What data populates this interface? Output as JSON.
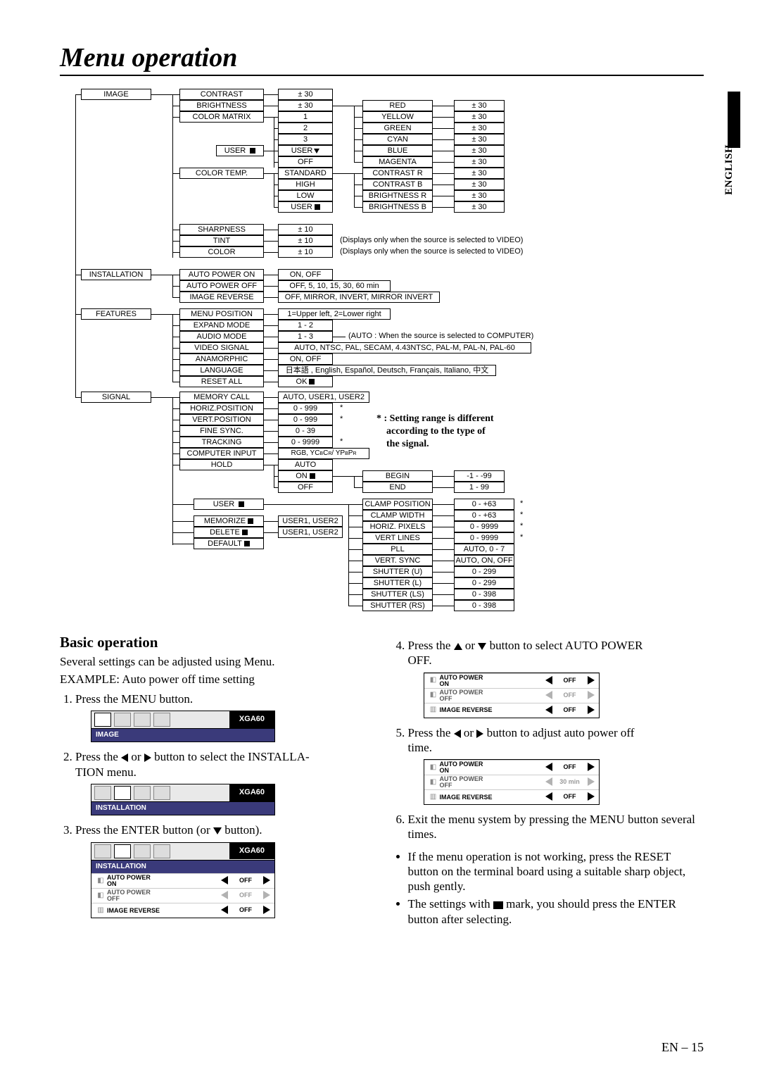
{
  "page": {
    "title": "Menu operation",
    "language_tab": "ENGLISH",
    "page_number": "EN – 15"
  },
  "tree": {
    "top": [
      {
        "label": "IMAGE",
        "items": [
          {
            "label": "CONTRAST",
            "value": "± 30"
          },
          {
            "label": "BRIGHTNESS",
            "value": "± 30"
          },
          {
            "label": "COLOR MATRIX",
            "sub": [
              {
                "value": "1"
              },
              {
                "value": "2"
              },
              {
                "value": "3"
              },
              {
                "value": "USER▼",
                "right": [
                  {
                    "label": "RED",
                    "value": "± 30"
                  },
                  {
                    "label": "YELLOW",
                    "value": "± 30"
                  },
                  {
                    "label": "GREEN",
                    "value": "± 30"
                  },
                  {
                    "label": "CYAN",
                    "value": "± 30"
                  },
                  {
                    "label": "BLUE",
                    "value": "± 30"
                  },
                  {
                    "label": "MAGENTA",
                    "value": "± 30"
                  }
                ]
              },
              {
                "value": "OFF"
              }
            ],
            "aside": {
              "label": "USER ■"
            }
          },
          {
            "label": "COLOR TEMP.",
            "sub": [
              {
                "value": "STANDARD",
                "right_label": "CONTRAST R",
                "right_value": "± 30"
              },
              {
                "value": "HIGH",
                "right_label": "CONTRAST B",
                "right_value": "± 30"
              },
              {
                "value": "LOW",
                "right_label": "BRIGHTNESS R",
                "right_value": "± 30"
              },
              {
                "value": "USER■",
                "right_label": "BRIGHTNESS B",
                "right_value": "± 30"
              }
            ]
          },
          {
            "label": "SHARPNESS",
            "value": "± 10"
          },
          {
            "label": "TINT",
            "value": "± 10",
            "note": "(Displays only when the source is selected to VIDEO)"
          },
          {
            "label": "COLOR",
            "value": "± 10",
            "note": "(Displays only when the source is selected to VIDEO)"
          }
        ]
      },
      {
        "label": "INSTALLATION",
        "items": [
          {
            "label": "AUTO POWER ON",
            "value": "ON, OFF"
          },
          {
            "label": "AUTO POWER OFF",
            "value": "OFF, 5, 10, 15, 30, 60 min"
          },
          {
            "label": "IMAGE REVERSE",
            "value": "OFF, MIRROR, INVERT, MIRROR INVERT"
          }
        ]
      },
      {
        "label": "FEATURES",
        "items": [
          {
            "label": "MENU POSITION",
            "value": "1=Upper left, 2=Lower right"
          },
          {
            "label": "EXPAND MODE",
            "value": "1 - 2"
          },
          {
            "label": "AUDIO MODE",
            "value": "1 - 3",
            "note": "(AUTO : When the source is selected to COMPUTER)"
          },
          {
            "label": "VIDEO SIGNAL",
            "value": "AUTO, NTSC, PAL, SECAM, 4.43NTSC, PAL-M, PAL-N, PAL-60"
          },
          {
            "label": "ANAMORPHIC",
            "value": "ON, OFF"
          },
          {
            "label": "LANGUAGE",
            "value": "日本語 , English, Español, Deutsch, Français, Italiano, 中文"
          },
          {
            "label": "RESET ALL",
            "value": "OK■"
          }
        ]
      },
      {
        "label": "SIGNAL",
        "items": [
          {
            "label": "MEMORY CALL",
            "value": "AUTO, USER1, USER2"
          },
          {
            "label": "HORIZ.POSITION",
            "value": "0 - 999",
            "ast": "*"
          },
          {
            "label": "VERT.POSITION",
            "value": "0 - 999",
            "ast": "*"
          },
          {
            "label": "FINE SYNC.",
            "value": "0 - 39"
          },
          {
            "label": "TRACKING",
            "value": "0 - 9999",
            "ast": "*"
          },
          {
            "label": "COMPUTER INPUT",
            "value": "RGB, YCBCR / YPBPR"
          },
          {
            "label": "HOLD",
            "sub": [
              {
                "value": "AUTO"
              },
              {
                "value": "ON■",
                "right_label": "BEGIN",
                "right_value": "-1 - -99"
              },
              {
                "value": "OFF",
                "right_label": "END",
                "right_value": "1 - 99"
              }
            ]
          },
          {
            "label": "USER ■"
          },
          {
            "label": "MEMORIZE■",
            "value": "USER1, USER2"
          },
          {
            "label": "DELETE■",
            "value": "USER1, USER2"
          },
          {
            "label": "DEFAULT■"
          }
        ],
        "right_block": [
          {
            "label": "CLAMP POSITION",
            "value": "0 - +63",
            "ast": "*"
          },
          {
            "label": "CLAMP WIDTH",
            "value": "0 - +63",
            "ast": "*"
          },
          {
            "label": "HORIZ. PIXELS",
            "value": "0 - 9999",
            "ast": "*"
          },
          {
            "label": "VERT LINES",
            "value": "0 - 9999",
            "ast": "*"
          },
          {
            "label": "PLL",
            "value": "AUTO, 0 - 7"
          },
          {
            "label": "VERT. SYNC",
            "value": "AUTO, ON, OFF"
          },
          {
            "label": "SHUTTER (U)",
            "value": "0 - 299"
          },
          {
            "label": "SHUTTER (L)",
            "value": "0 - 299"
          },
          {
            "label": "SHUTTER (LS)",
            "value": "0 - 398"
          },
          {
            "label": "SHUTTER (RS)",
            "value": "0 - 398"
          }
        ]
      }
    ],
    "setting_note": "* : Setting range is different according to the type of the signal."
  },
  "basic": {
    "heading": "Basic operation",
    "intro": "Several settings can be adjusted using Menu.",
    "example": "EXAMPLE: Auto power off time setting",
    "steps_left": [
      "Press the MENU button.",
      "Press the ◀ or ▶ button to select the INSTALLATION menu.",
      "Press the ENTER button (or ▼ button)."
    ],
    "steps_right": [
      "Press the ▲ or ▼ button to select AUTO POWER OFF.",
      "Press the ◀ or ▶ button to adjust auto power off time.",
      "Exit the menu system by pressing the MENU button several times."
    ],
    "bullets": [
      "If the menu operation is not working, press the RESET button on the terminal board using a suitable sharp object, push gently.",
      "The settings with ■ mark, you should press the ENTER button after selecting."
    ],
    "osd": {
      "mode": "XGA60",
      "strip1": "IMAGE",
      "strip2": "INSTALLATION",
      "rows": {
        "apon": {
          "label": "AUTO POWER ON",
          "value": "OFF"
        },
        "apoff": {
          "label": "AUTO POWER OFF",
          "value": "OFF"
        },
        "apoff30": {
          "label": "AUTO POWER OFF",
          "value": "30 min"
        },
        "imrev": {
          "label": "IMAGE REVERSE",
          "value": "OFF"
        }
      }
    }
  }
}
